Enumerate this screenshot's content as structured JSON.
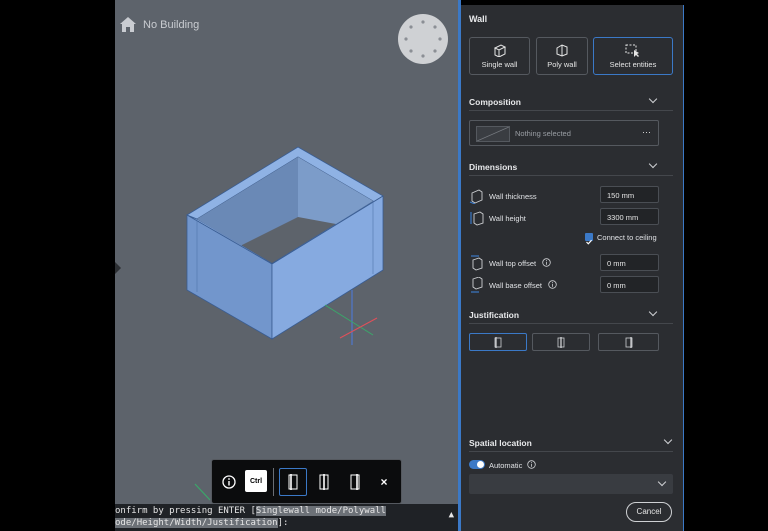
{
  "viewport": {
    "building_label": "No Building",
    "icons": {
      "home": "home-icon",
      "compass": "view-cube-compass"
    }
  },
  "command": {
    "line1_prefix": "onfirm by pressing ENTER [",
    "line1_opt1_key": "S",
    "line1_opt1_rest": "inglewall mode/",
    "line1_opt2_key": "P",
    "line1_opt2_rest": "olywall",
    "line2_prefix": "ode/",
    "line2_opt3_key": "H",
    "line2_opt3_rest": "eight/",
    "line2_opt4_key": "W",
    "line2_opt4_rest": "idth/",
    "line2_opt5_key": "J",
    "line2_opt5_rest": "ustification",
    "line2_suffix": "]:"
  },
  "floating_toolbar": {
    "ctrl_label": "Ctrl",
    "close_label": "×"
  },
  "panel": {
    "title": "Wall",
    "modes": [
      {
        "label": "Single wall",
        "icon": "single-wall-icon"
      },
      {
        "label": "Poly wall",
        "icon": "poly-wall-icon"
      },
      {
        "label": "Select entities",
        "icon": "select-entities-icon",
        "selected": true
      }
    ],
    "composition": {
      "title": "Composition",
      "value": "Nothing selected",
      "more_label": "···"
    },
    "dimensions": {
      "title": "Dimensions",
      "wall_thickness_label": "Wall thickness",
      "wall_thickness_value": "150 mm",
      "wall_height_label": "Wall height",
      "wall_height_value": "3300 mm",
      "connect_to_ceiling_label": "Connect to ceiling",
      "connect_to_ceiling_checked": true,
      "wall_top_offset_label": "Wall top offset",
      "wall_top_offset_value": "0 mm",
      "wall_base_offset_label": "Wall base offset",
      "wall_base_offset_value": "0 mm"
    },
    "justification": {
      "title": "Justification",
      "selected_index": 0
    },
    "spatial_location": {
      "title": "Spatial location",
      "automatic_label": "Automatic",
      "automatic_on": true
    },
    "cancel_label": "Cancel"
  },
  "colors": {
    "accent": "#3b79c7",
    "wall_fill": "#7fa7dc",
    "viewport_bg": "#5d636b",
    "panel_bg": "#2b2d31"
  }
}
